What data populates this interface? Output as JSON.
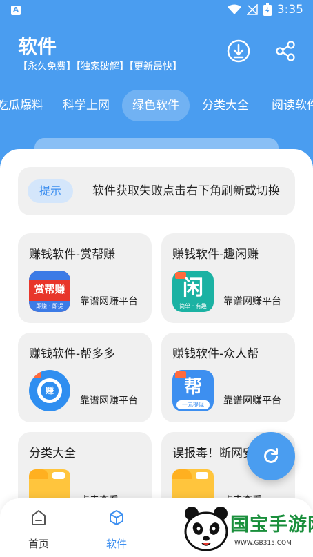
{
  "status_bar": {
    "time": "3:35",
    "icons": [
      "app-icon",
      "wifi-icon",
      "no-signal-icon",
      "battery-charging-icon"
    ]
  },
  "header": {
    "title": "软件",
    "subtitle": "【永久免费】【独家破解】【更新最快】",
    "buttons": [
      "download-icon",
      "share-icon"
    ]
  },
  "tabs": [
    {
      "label": "吃瓜爆料"
    },
    {
      "label": "科学上网"
    },
    {
      "label": "绿色软件",
      "active": true
    },
    {
      "label": "分类大全"
    },
    {
      "label": "阅读软件"
    }
  ],
  "notice": {
    "badge": "提示",
    "text": "软件获取失败点击右下角刷新或切换"
  },
  "cards": [
    {
      "title": "赚钱软件-赏帮赚",
      "subtitle": "靠谱网赚平台",
      "icon": "shangbangzhuan-app-icon",
      "icon_text": "赏帮赚",
      "icon_sub": "即赚 · 即提"
    },
    {
      "title": "赚钱软件-趣闲赚",
      "subtitle": "靠谱网赚平台",
      "icon": "quxianzhuan-app-icon",
      "icon_text": "闲",
      "icon_sub": "简单 · 有趣"
    },
    {
      "title": "赚钱软件-帮多多",
      "subtitle": "靠谱网赚平台",
      "icon": "bangduoduo-app-icon",
      "icon_text": "赚",
      "icon_sub": ""
    },
    {
      "title": "赚钱软件-众人帮",
      "subtitle": "靠谱网赚平台",
      "icon": "zhongrenbang-app-icon",
      "icon_text": "帮",
      "icon_sub": "一元提现"
    },
    {
      "title": "分类大全",
      "subtitle": "点击查看",
      "icon": "folder-icon",
      "icon_text": "",
      "icon_sub": ""
    },
    {
      "title": "误报毒！断网安装",
      "subtitle": "点击查看",
      "icon": "folder-icon",
      "icon_text": "",
      "icon_sub": ""
    }
  ],
  "fab": {
    "icon": "refresh-icon"
  },
  "bottom_nav": [
    {
      "label": "首页",
      "icon": "home-icon"
    },
    {
      "label": "软件",
      "icon": "cube-icon",
      "active": true
    }
  ],
  "watermark": {
    "title": "国宝手游网",
    "url": "WWW.GB315.COM"
  },
  "colors": {
    "primary": "#4a9df0",
    "accent": "#3d8ff0",
    "card_bg": "#f0f0f0",
    "badge_bg": "#d4e6fb",
    "watermark_green": "#1a8f3c"
  }
}
